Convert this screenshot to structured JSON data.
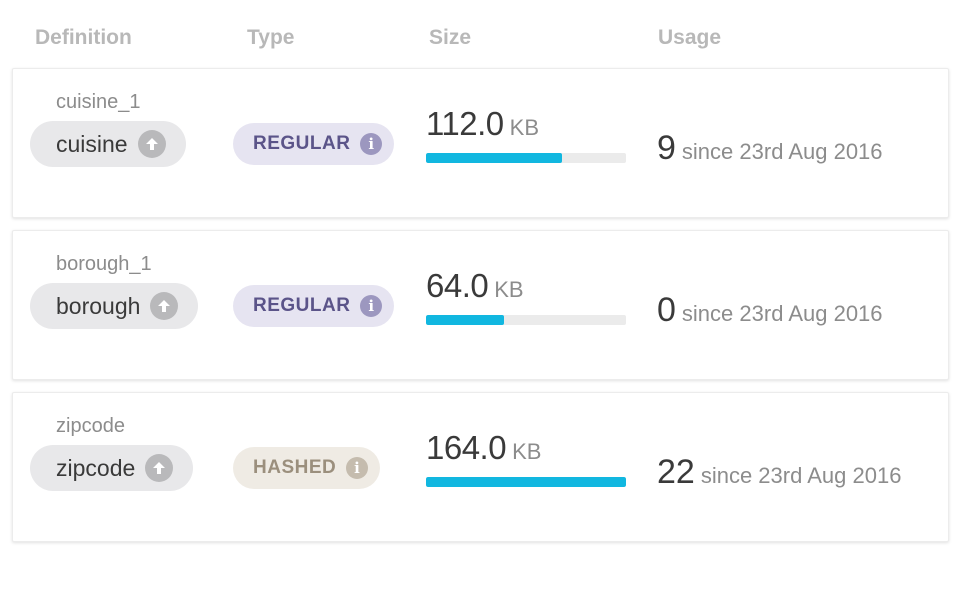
{
  "header": {
    "definition": "Definition",
    "type": "Type",
    "size": "Size",
    "usage": "Usage"
  },
  "rows": [
    {
      "name": "cuisine_1",
      "field": "cuisine",
      "type": "REGULAR",
      "size_value": "112.0",
      "size_unit": "KB",
      "size_fraction": 0.68,
      "usage_count": "9",
      "usage_since": "since 23rd Aug 2016"
    },
    {
      "name": "borough_1",
      "field": "borough",
      "type": "REGULAR",
      "size_value": "64.0",
      "size_unit": "KB",
      "size_fraction": 0.39,
      "usage_count": "0",
      "usage_since": "since 23rd Aug 2016"
    },
    {
      "name": "zipcode",
      "field": "zipcode",
      "type": "HASHED",
      "size_value": "164.0",
      "size_unit": "KB",
      "size_fraction": 1.0,
      "usage_count": "22",
      "usage_since": "since 23rd Aug 2016"
    }
  ],
  "colors": {
    "bar_fill": "#11b7e0",
    "regular_badge": "#e6e4f1",
    "hashed_badge": "#efebe4"
  },
  "icons": {
    "field": "arrow-up-circle-icon",
    "type": "info-icon"
  }
}
